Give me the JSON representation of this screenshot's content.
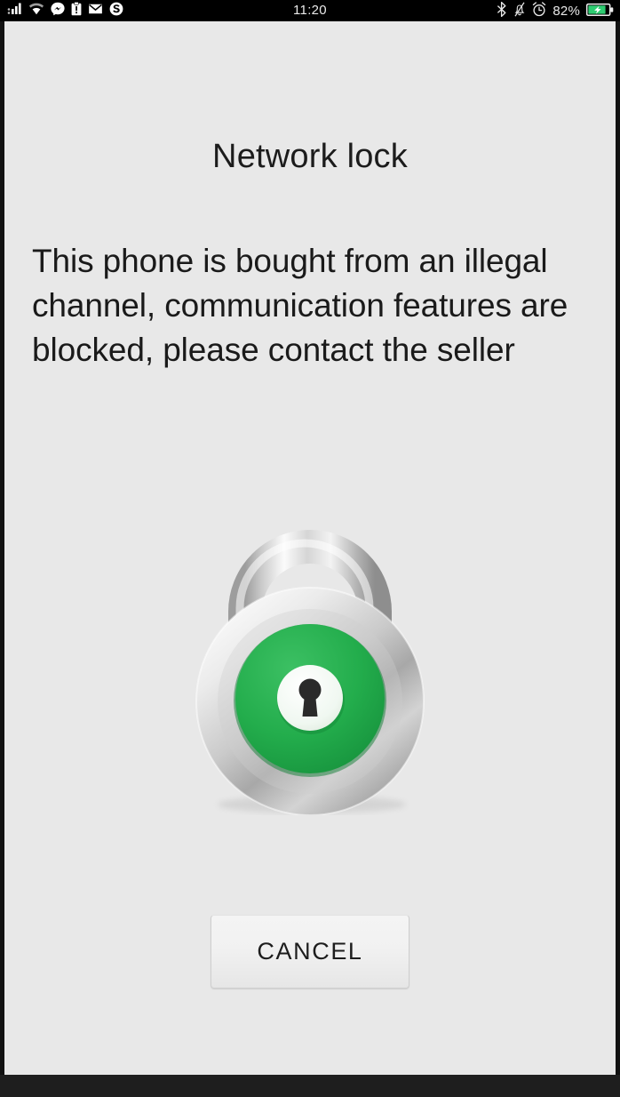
{
  "status_bar": {
    "time": "11:20",
    "battery_percent": "82%",
    "left_icons": [
      {
        "name": "signal-bars-icon",
        "label": "cellular signal"
      },
      {
        "name": "wifi-icon",
        "label": "wifi"
      },
      {
        "name": "messenger-icon",
        "label": "messenger notification"
      },
      {
        "name": "clipboard-icon",
        "label": "clipboard notification"
      },
      {
        "name": "gmail-icon",
        "label": "gmail notification"
      },
      {
        "name": "skype-icon",
        "label": "skype notification"
      }
    ],
    "right_icons": [
      {
        "name": "bluetooth-icon",
        "label": "bluetooth on"
      },
      {
        "name": "bell-muted-icon",
        "label": "ringer silenced"
      },
      {
        "name": "alarm-clock-icon",
        "label": "alarm set"
      },
      {
        "name": "battery-charging-icon",
        "label": "battery charging"
      }
    ]
  },
  "dialog": {
    "title": "Network lock",
    "message": "This phone is bought from an illegal channel, communication features are blocked, please contact the seller",
    "icon": {
      "name": "padlock-locked-icon",
      "shackle_color": "#c9c9c9",
      "body_color": "#d6d6d6",
      "dial_color": "#22ab4b",
      "keyhole_plate_color": "#eef7f0",
      "keyhole_color": "#2a2a2a"
    },
    "cancel_label": "CANCEL"
  },
  "colors": {
    "status_bar_bg": "#000000",
    "screen_bg": "#e8e8e8",
    "frame": "#121212",
    "title_text": "#1c1c1c",
    "body_text": "#1a1a1a",
    "battery_green": "#2ecc71"
  }
}
